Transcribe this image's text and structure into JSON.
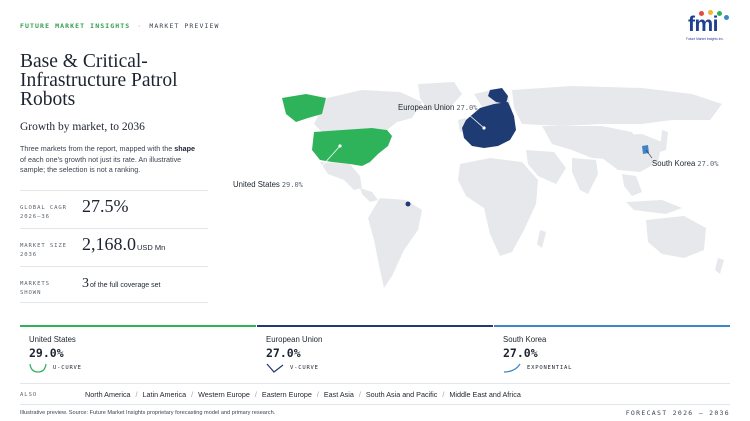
{
  "header": {
    "brand": "FUTURE MARKET INSIGHTS",
    "separator": "·",
    "section": "MARKET PREVIEW",
    "logo_text": "fmi",
    "logo_tagline": "Future Market Insights Inc."
  },
  "title": "Base & Critical-Infrastructure Patrol Robots",
  "subtitle": "Growth by market, to 2036",
  "description": {
    "part1": "Three markets from the report, mapped with the ",
    "bold": "shape",
    "part2": " of each one's growth not just its rate. An illustrative sample; the selection is not a ranking."
  },
  "stats": [
    {
      "label_line1": "GLOBAL CAGR",
      "label_line2": "2026–36",
      "value": "27.5%",
      "unit": ""
    },
    {
      "label_line1": "MARKET SIZE",
      "label_line2": "2036",
      "value": "2,168.0",
      "unit": "USD Mn"
    },
    {
      "label_line1": "MARKETS",
      "label_line2": "SHOWN",
      "value": "3",
      "unit": "of the full coverage set"
    }
  ],
  "map_labels": [
    {
      "name": "European Union",
      "pct": "27.0%"
    },
    {
      "name": "South Korea",
      "pct": "27.0%"
    },
    {
      "name": "United States",
      "pct": "29.0%"
    }
  ],
  "cards": [
    {
      "name": "United States",
      "value": "29.0%",
      "shape": "U-CURVE",
      "accent": "#2fb35a"
    },
    {
      "name": "European Union",
      "value": "27.0%",
      "shape": "V-CURVE",
      "accent": "#1f3b73"
    },
    {
      "name": "South Korea",
      "value": "27.0%",
      "shape": "EXPONENTIAL",
      "accent": "#3f86c8"
    }
  ],
  "also": {
    "label": "ALSO",
    "regions": [
      "North America",
      "Latin America",
      "Western Europe",
      "Eastern Europe",
      "East Asia",
      "South Asia and Pacific",
      "Middle East and Africa"
    ]
  },
  "footnote": "Illustrative preview. Source: Future Market Insights proprietary forecasting model and primary research.",
  "forecast": "FORECAST 2026 – 2036",
  "colors": {
    "us": "#2fb35a",
    "eu": "#1f3b73",
    "kr": "#3f86c8",
    "land": "#e6e8eb",
    "brand_green": "#2f9e4f"
  }
}
